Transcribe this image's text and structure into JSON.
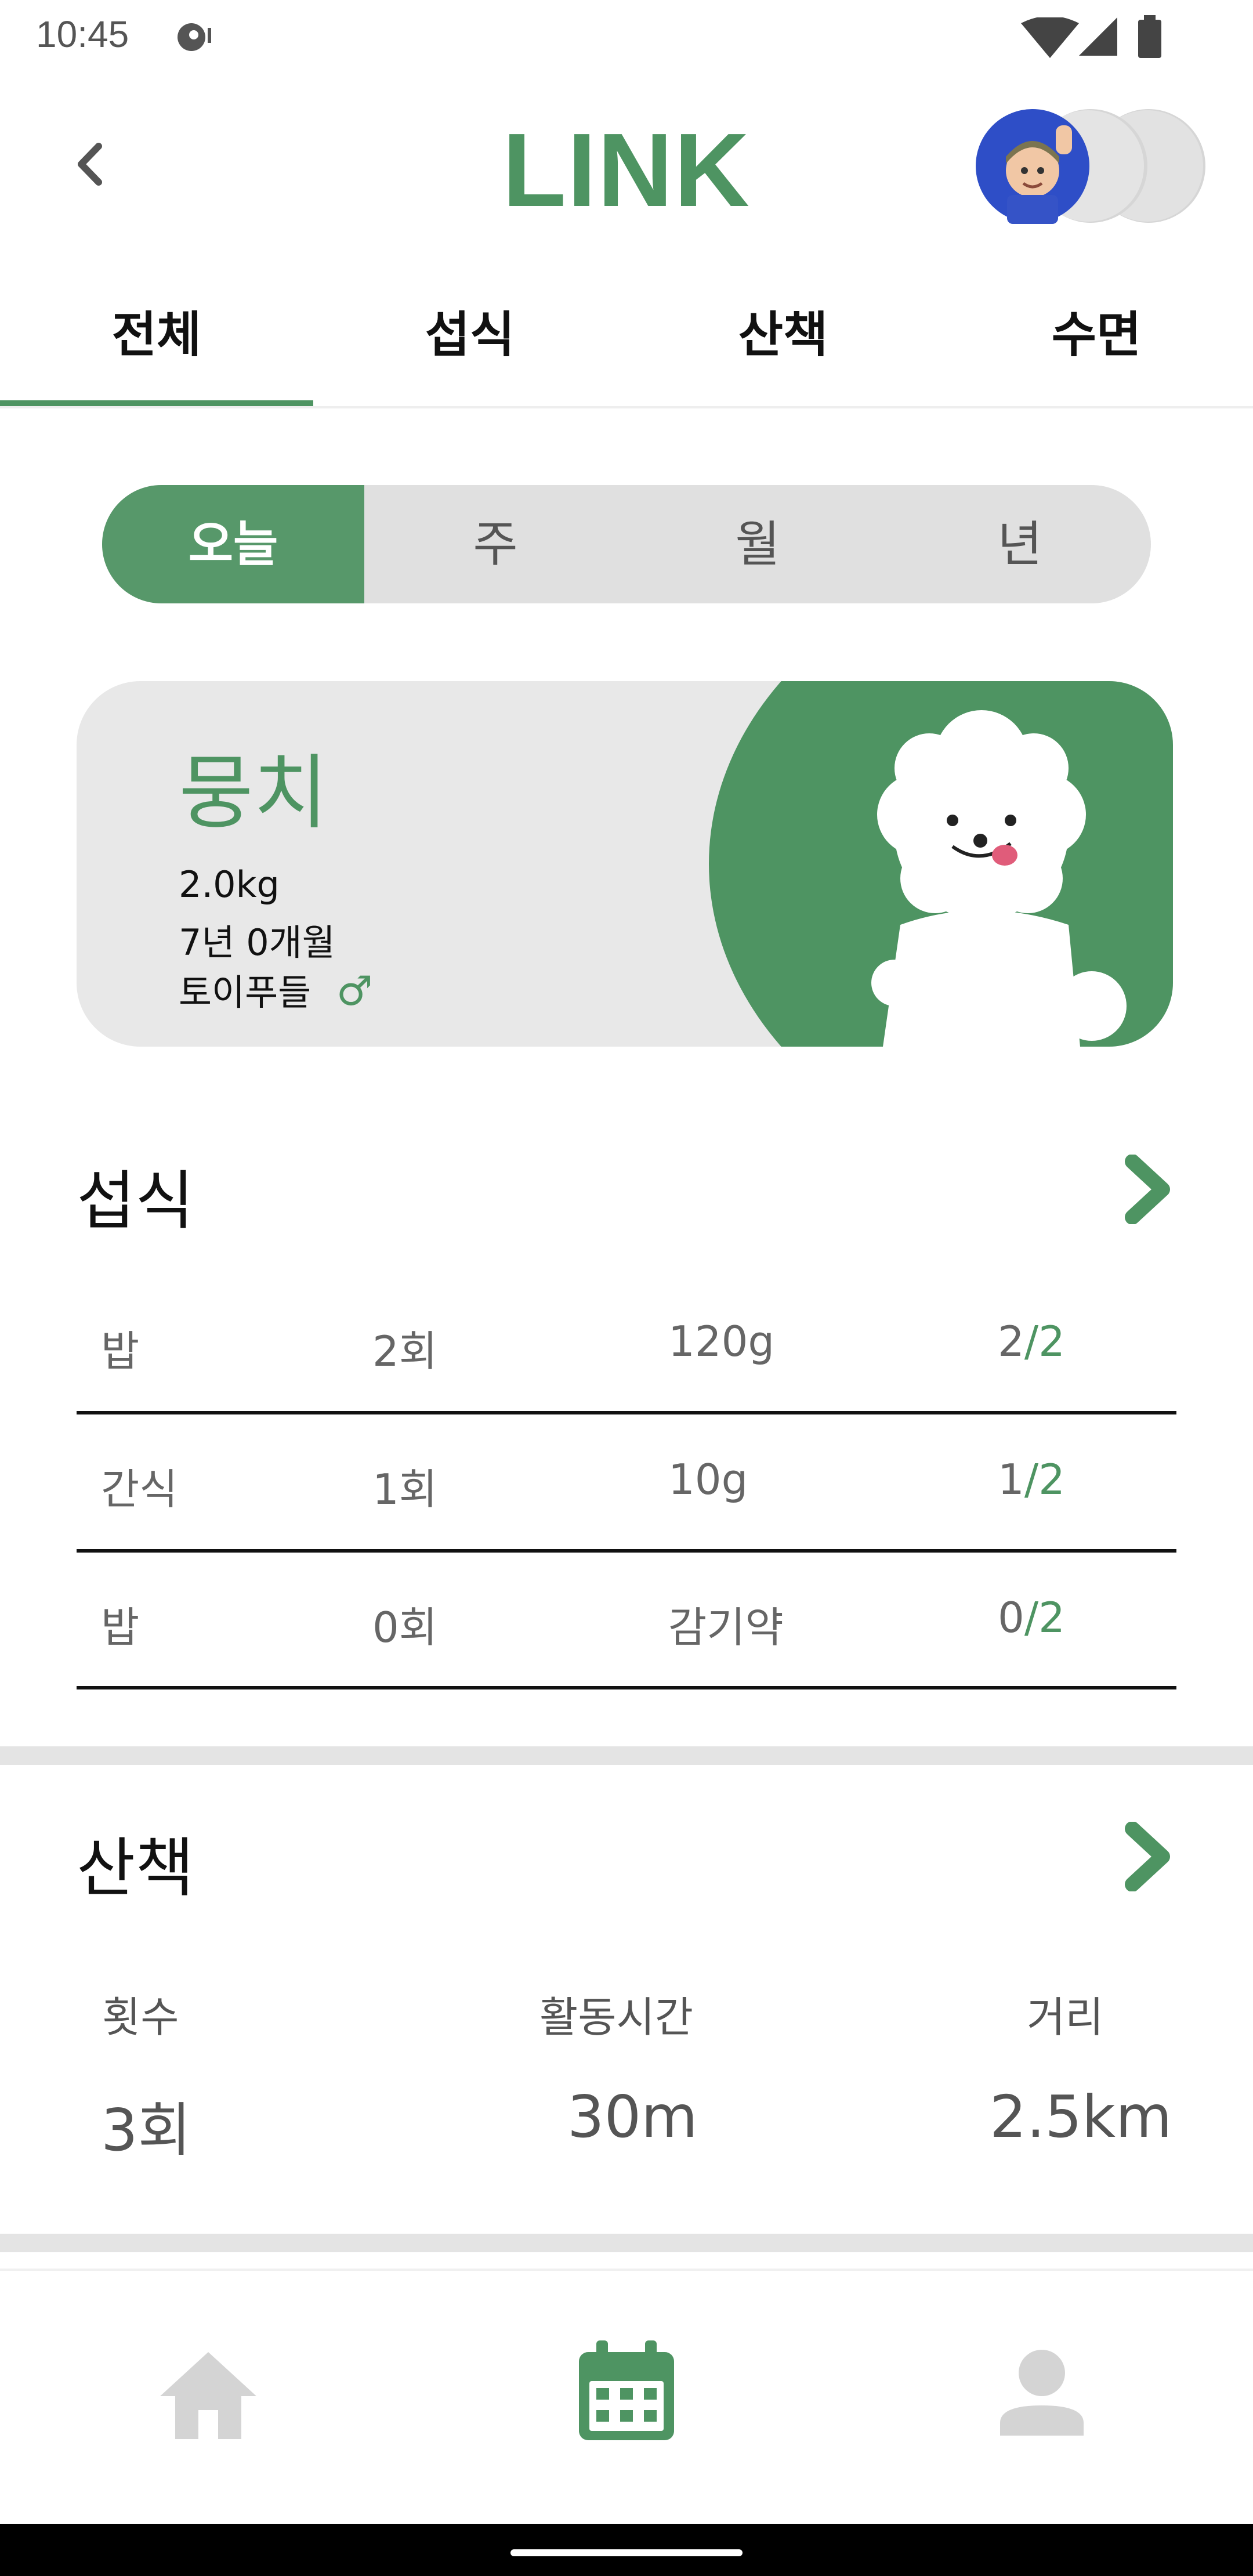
{
  "status_bar": {
    "time": "10:45"
  },
  "header": {
    "title": "LINK"
  },
  "tabs": [
    {
      "label": "전체",
      "active": true
    },
    {
      "label": "섭식"
    },
    {
      "label": "산책"
    },
    {
      "label": "수면"
    }
  ],
  "period": [
    {
      "label": "오늘",
      "active": true
    },
    {
      "label": "주"
    },
    {
      "label": "월"
    },
    {
      "label": "년"
    }
  ],
  "pet": {
    "name": "뭉치",
    "weight": "2.0kg",
    "age": "7년 0개월",
    "breed": "토이푸들",
    "gender_symbol": "♂"
  },
  "feeding": {
    "title": "섭식",
    "rows": [
      {
        "type": "밥",
        "count": "2회",
        "amount": "120g",
        "done": "2",
        "total": "/2"
      },
      {
        "type": "간식",
        "count": "1회",
        "amount": "10g",
        "done": "1",
        "total": "/2"
      },
      {
        "type": "밥",
        "count": "0회",
        "amount": "감기약",
        "done": "0",
        "total": "/2"
      }
    ]
  },
  "walk": {
    "title": "산책",
    "labels": {
      "count": "횟수",
      "time": "활동시간",
      "distance": "거리"
    },
    "values": {
      "count": "3회",
      "time": "30m",
      "distance": "2.5km"
    }
  },
  "colors": {
    "accent": "#4e9462",
    "segment_bg": "#e0e0e0",
    "card_bg": "#e8e8e8"
  },
  "nav": {
    "items": [
      {
        "icon": "home-icon",
        "active": false
      },
      {
        "icon": "calendar-icon",
        "active": true
      },
      {
        "icon": "person-icon",
        "active": false
      }
    ]
  }
}
